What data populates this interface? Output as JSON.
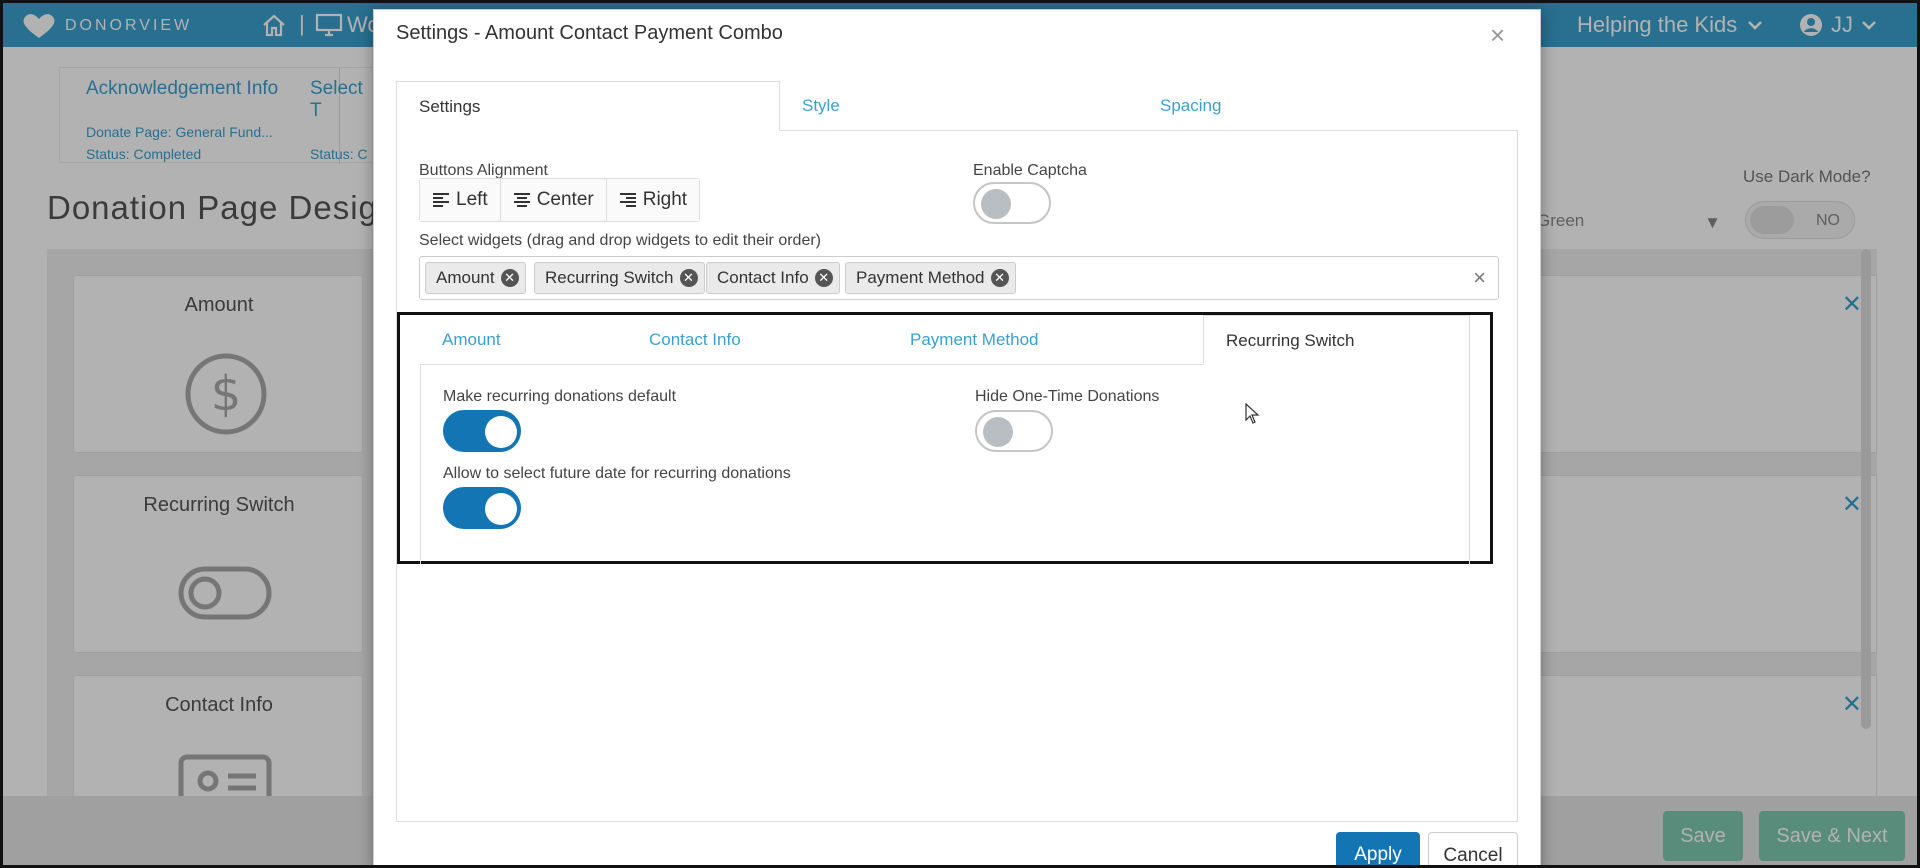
{
  "topbar": {
    "brand": "DONORVIEW",
    "nav_label": "Wo",
    "separator": "|",
    "organization": "Helping the Kids",
    "user_initials": "JJ",
    "bg_color": "#3aa0cf"
  },
  "background_page": {
    "breadcrumb": {
      "step1_title": "Acknowledgement Info",
      "step1_page": "Donate Page: General Fund...",
      "step1_status": "Status: Completed",
      "step2_title": "Select T",
      "step2_status": "Status: C"
    },
    "page_title": "Donation Page Desig",
    "dark_mode_label": "Use Dark Mode?",
    "dark_mode_value": "NO",
    "theme_value": "Green",
    "widgets": [
      {
        "title": "Amount",
        "icon": "dollar-circle-icon"
      },
      {
        "title": "Recurring Switch",
        "icon": "toggle-switch-icon"
      },
      {
        "title": "Contact Info",
        "icon": "id-card-icon"
      }
    ],
    "footer": {
      "save_label": "Save",
      "save_next_label": "Save & Next"
    }
  },
  "modal": {
    "title": "Settings - Amount Contact Payment Combo",
    "close": "×",
    "tabs": [
      {
        "label": "Settings",
        "active": true
      },
      {
        "label": "Style",
        "active": false
      },
      {
        "label": "Spacing",
        "active": false
      }
    ],
    "settings": {
      "buttons_alignment_label": "Buttons Alignment",
      "alignment_options": [
        "Left",
        "Center",
        "Right"
      ],
      "enable_captcha_label": "Enable Captcha",
      "enable_captcha": false,
      "select_widgets_label": "Select widgets (drag and drop widgets to edit their order)",
      "selected_widgets": [
        "Amount",
        "Recurring Switch",
        "Contact Info",
        "Payment Method"
      ],
      "clear_all": "×"
    },
    "widget_tabs": [
      {
        "label": "Amount",
        "active": false
      },
      {
        "label": "Contact Info",
        "active": false
      },
      {
        "label": "Payment Method",
        "active": false
      },
      {
        "label": "Recurring Switch",
        "active": true
      }
    ],
    "recurring": {
      "make_default_label": "Make recurring donations default",
      "make_default": true,
      "hide_one_time_label": "Hide One-Time Donations",
      "hide_one_time": false,
      "future_date_label": "Allow to select future date for recurring donations",
      "future_date": true
    },
    "apply_label": "Apply",
    "cancel_label": "Cancel",
    "accent_color": "#1475b4",
    "link_color": "#3aa0cf"
  }
}
